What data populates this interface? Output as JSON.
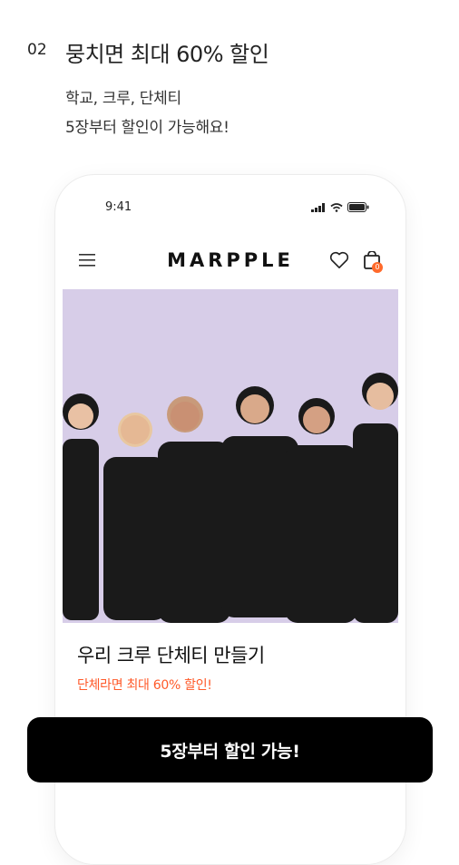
{
  "promo": {
    "step": "02",
    "headline": "뭉치면 최대 60% 할인",
    "sub_line1": "학교, 크루, 단체티",
    "sub_line2": "5장부터 할인이 가능해요!"
  },
  "phone": {
    "status_time": "9:41",
    "brand": "MARPPLE",
    "cart_count": "0",
    "card_title": "우리 크루 단체티 만들기",
    "card_subtitle": "단체라면 최대 60% 할인!"
  },
  "cta": {
    "label": "5장부터 할인 가능!"
  },
  "colors": {
    "accent": "#ff5a2a",
    "banner_bg": "#d7cde8",
    "cta_bg": "#000000"
  },
  "icons": [
    "menu-icon",
    "heart-icon",
    "shopping-bag-icon",
    "signal-icon",
    "wifi-icon",
    "battery-icon"
  ]
}
